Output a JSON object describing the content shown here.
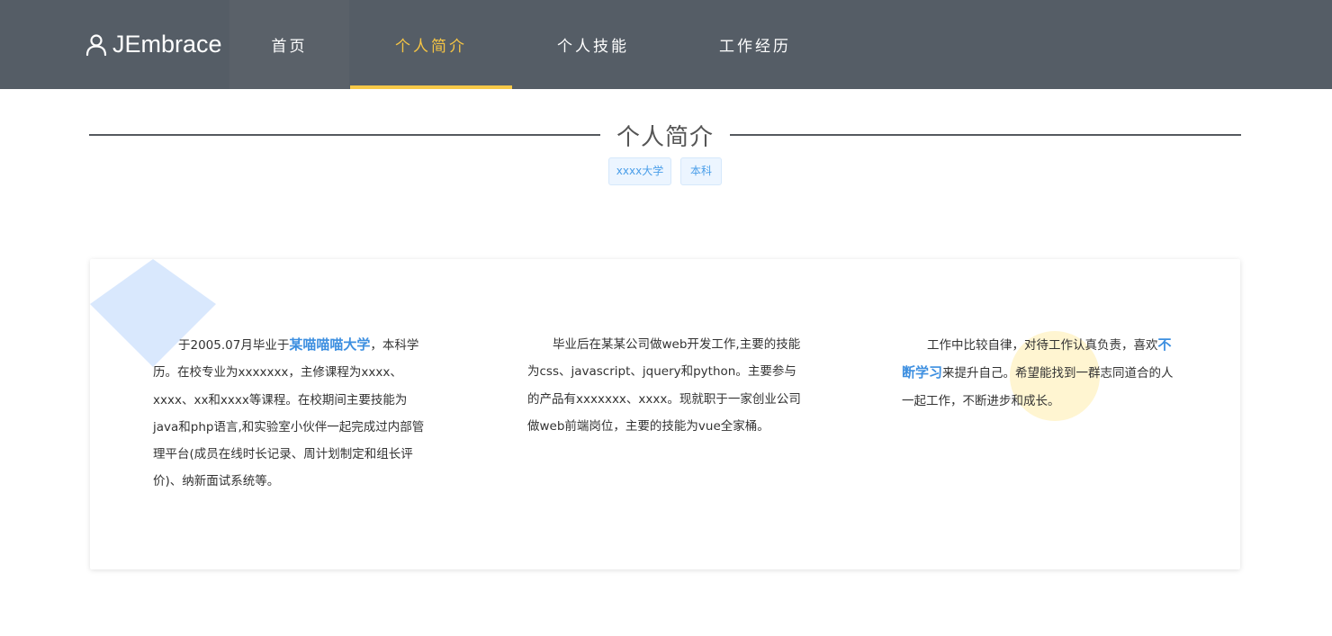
{
  "header": {
    "logo_text": "JEmbrace",
    "nav": [
      {
        "label": "首页",
        "active": false
      },
      {
        "label": "个人简介",
        "active": true
      },
      {
        "label": "个人技能",
        "active": false
      },
      {
        "label": "工作经历",
        "active": false
      }
    ]
  },
  "section": {
    "title": "个人简介",
    "tags": [
      "xxxx大学",
      "本科"
    ]
  },
  "paragraphs": [
    {
      "pre": "于2005.07月毕业于",
      "highlight": "某喵喵喵大学",
      "post": "，本科学历。在校专业为xxxxxxx，主修课程为xxxx、xxxx、xx和xxxx等课程。在校期间主要技能为java和php语言,和实验室小伙伴一起完成过内部管理平台(成员在线时长记录、周计划制定和组长评价)、纳新面试系统等。"
    },
    {
      "pre": "毕业后在某某公司做web开发工作,主要的技能为css、javascript、jquery和python。主要参与的产品有xxxxxxx、xxxx。现就职于一家创业公司做web前端岗位，主要的技能为vue全家桶。",
      "highlight": "",
      "post": ""
    },
    {
      "pre": "工作中比较自律，对待工作认真负责，喜欢",
      "highlight": "不断学习",
      "post": "来提升自己。希望能找到一群志同道合的人一起工作，不断进步和成长。"
    }
  ],
  "colors": {
    "header_bg": "#555d66",
    "nav_active": "#f5c444",
    "accent_blue": "#3d8fe0",
    "tag_bg": "#ecf5ff",
    "diamond": "#d9e8fd",
    "yellow_dot": "#fff4cc"
  },
  "icons": {
    "logo": "user-icon"
  }
}
